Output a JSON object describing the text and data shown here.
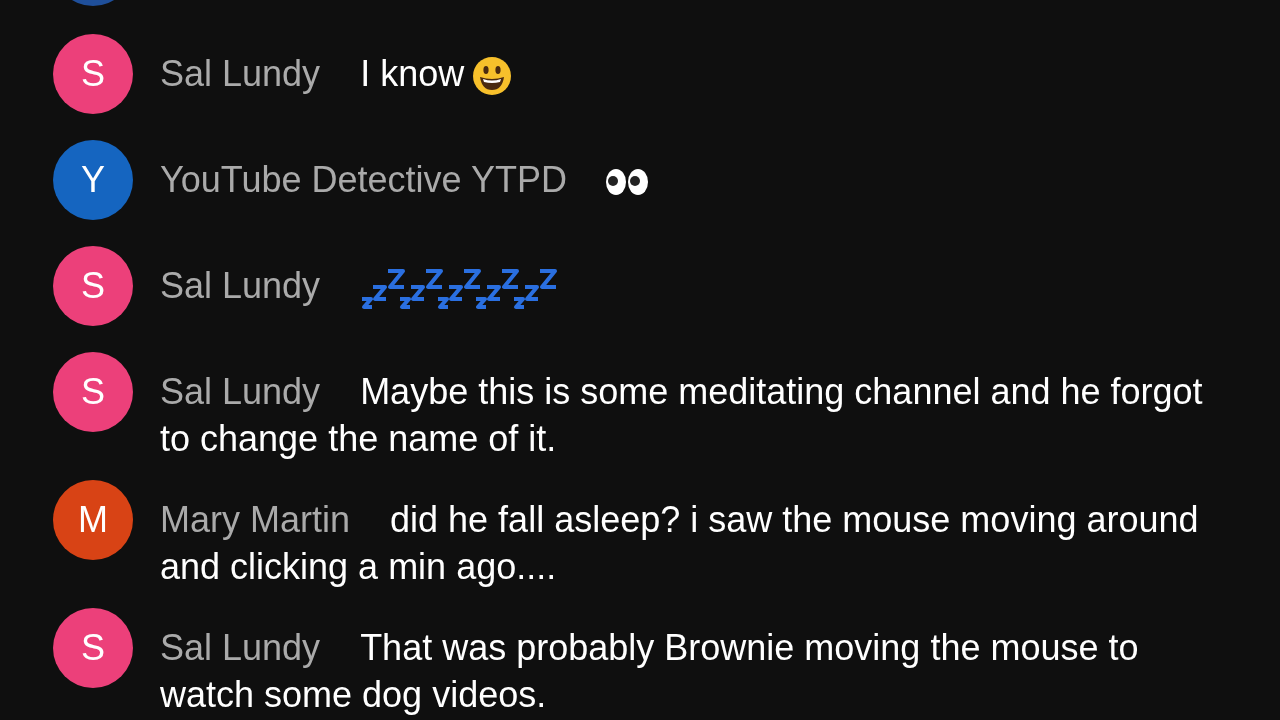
{
  "partial_avatar": {
    "color": "#1f4f9a"
  },
  "messages": [
    {
      "initial": "S",
      "color": "#ec407a",
      "author": "Sal Lundy",
      "text": "I know",
      "emoji": [
        {
          "kind": "smiley"
        }
      ]
    },
    {
      "initial": "Y",
      "color": "#1565c0",
      "author": "YouTube Detective YTPD",
      "emoji": [
        {
          "kind": "eyes"
        }
      ]
    },
    {
      "initial": "S",
      "color": "#ec407a",
      "author": "Sal Lundy",
      "emoji": [
        {
          "kind": "zzz"
        },
        {
          "kind": "zzz"
        },
        {
          "kind": "zzz"
        },
        {
          "kind": "zzz"
        },
        {
          "kind": "zzz"
        }
      ]
    },
    {
      "initial": "S",
      "color": "#ec407a",
      "author": "Sal Lundy",
      "text": "Maybe this is some meditating channel and he forgot to change the name of it."
    },
    {
      "initial": "M",
      "color": "#d84315",
      "author": "Mary Martin",
      "text": "did he fall asleep? i saw the mouse moving around and clicking a min ago...."
    },
    {
      "initial": "S",
      "color": "#ec407a",
      "author": "Sal Lundy",
      "text": "That was probably Brownie moving the mouse to watch some dog videos."
    }
  ]
}
